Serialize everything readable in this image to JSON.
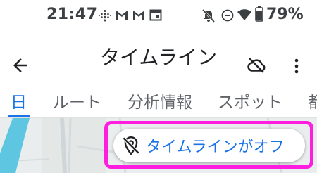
{
  "status_bar": {
    "time": "21:47",
    "battery_percent": "79%",
    "icons": [
      "fitbit-icon",
      "gmail-icon",
      "gmail-icon",
      "calendar-icon",
      "mute-icon",
      "dnd-icon",
      "wifi-icon",
      "battery-icon"
    ]
  },
  "app_bar": {
    "title": "タイムライン",
    "back_icon": "arrow-back-icon",
    "cloud_icon": "cloud-off-icon",
    "more_icon": "more-vert-icon"
  },
  "tabs": [
    {
      "label": "日",
      "active": true
    },
    {
      "label": "ルート",
      "active": false
    },
    {
      "label": "分析情報",
      "active": false
    },
    {
      "label": "スポット",
      "active": false
    },
    {
      "label": "都",
      "active": false
    }
  ],
  "chip": {
    "label": "タイムラインがオフ",
    "icon": "location-off-icon"
  },
  "colors": {
    "accent": "#1a73e8",
    "highlight": "#ff1ee0",
    "water": "#5ec6e0",
    "map_bg": "#e9eded"
  }
}
